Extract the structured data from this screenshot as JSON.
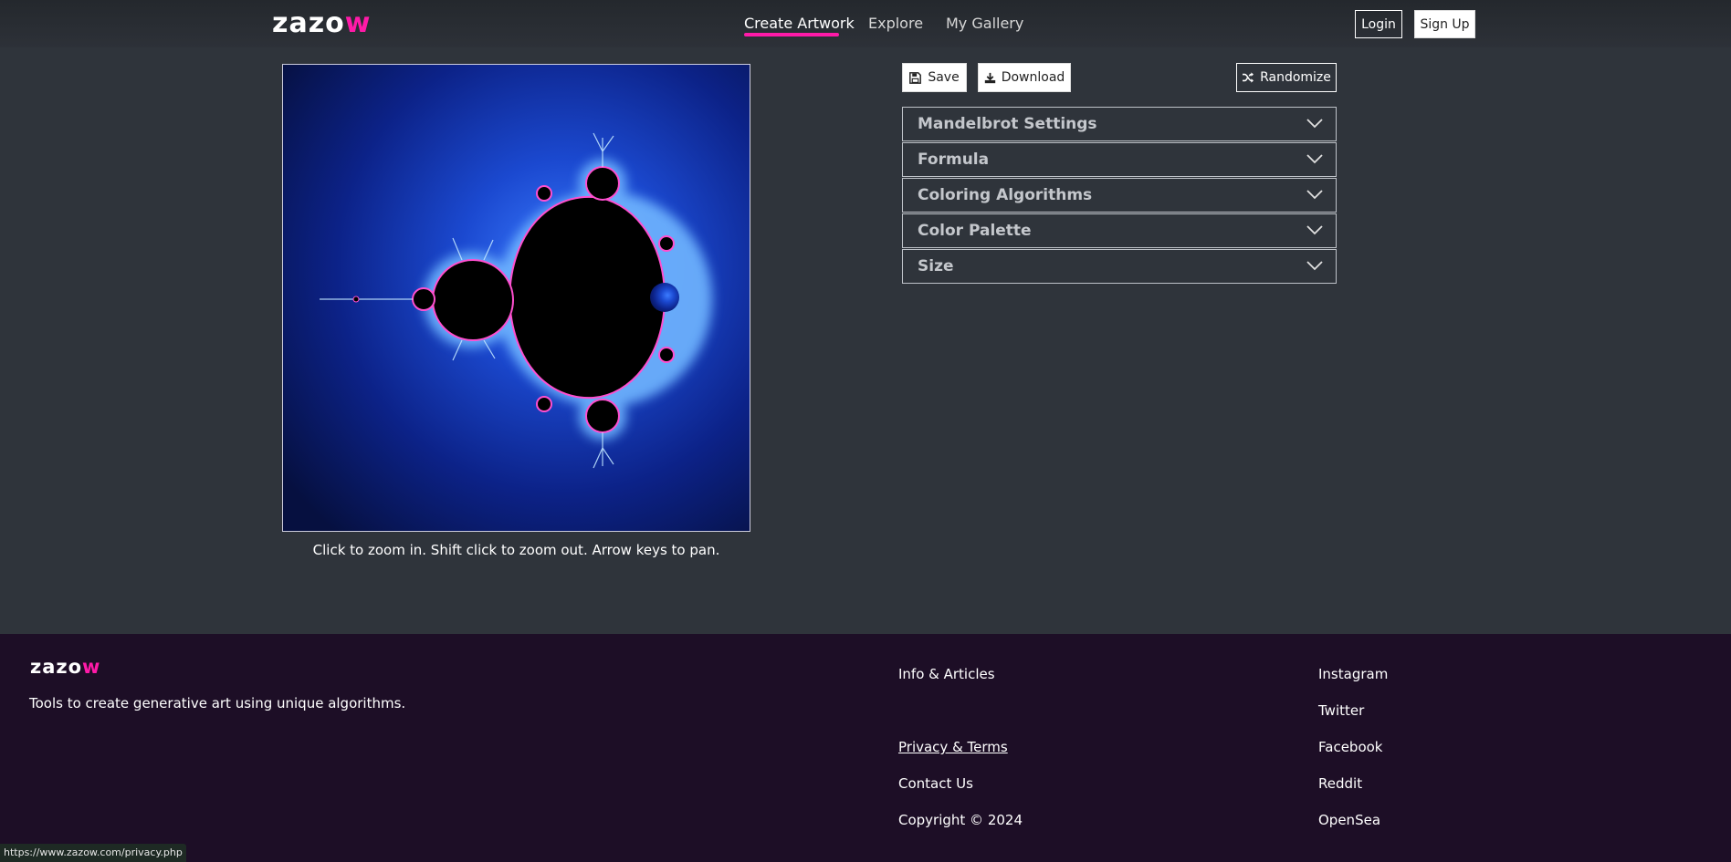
{
  "brand": {
    "name_main": "zazo",
    "name_accent": "w",
    "accent_color": "#ff1aa8"
  },
  "nav": {
    "create": "Create Artwork",
    "explore": "Explore",
    "gallery": "My Gallery"
  },
  "auth": {
    "login": "Login",
    "signup": "Sign Up"
  },
  "toolbar": {
    "save": "Save",
    "download": "Download",
    "randomize": "Randomize",
    "save_icon": "floppy-disk-icon",
    "download_icon": "download-icon",
    "randomize_icon": "shuffle-icon"
  },
  "panels": [
    {
      "title": "Mandelbrot Settings"
    },
    {
      "title": "Formula"
    },
    {
      "title": "Coloring Algorithms"
    },
    {
      "title": "Color Palette"
    },
    {
      "title": "Size"
    }
  ],
  "canvas": {
    "hint": "Click to zoom in. Shift click to zoom out. Arrow keys to pan."
  },
  "footer": {
    "tagline": "Tools to create generative art using unique algorithms.",
    "col1": [
      "Info & Articles",
      "Privacy & Terms",
      "Contact Us",
      "Copyright © 2024"
    ],
    "col2": [
      "Instagram",
      "Twitter",
      "Facebook",
      "Reddit",
      "OpenSea"
    ]
  },
  "status_url": "https://www.zazow.com/privacy.php"
}
